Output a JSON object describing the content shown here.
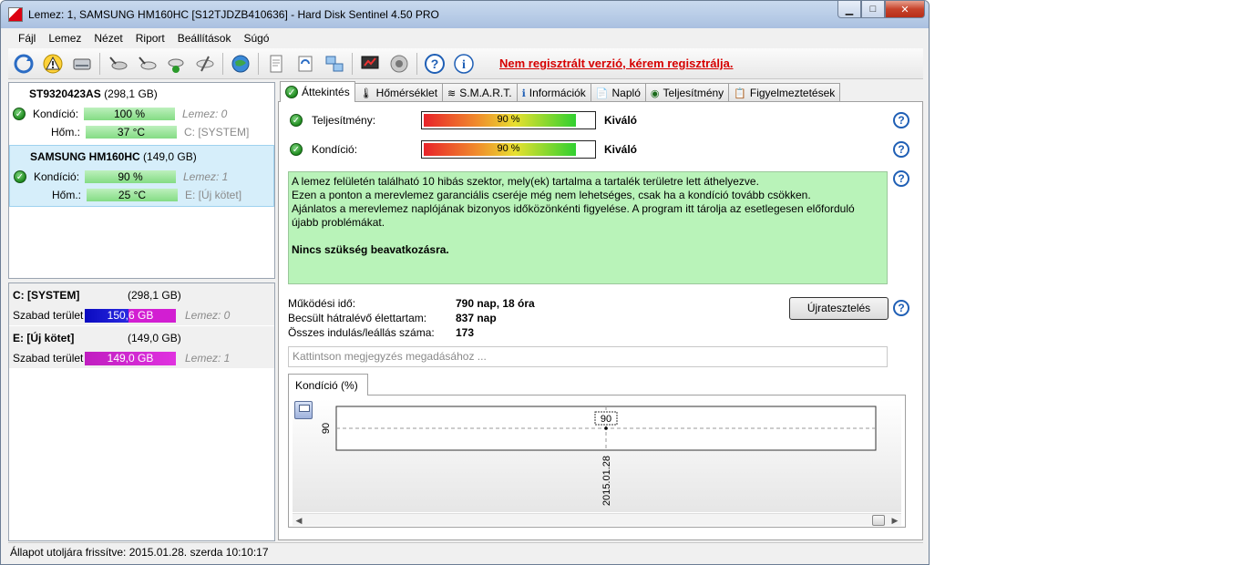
{
  "window": {
    "title": "Lemez: 1, SAMSUNG HM160HC [S12TJDZB410636]  -  Hard Disk Sentinel 4.50 PRO",
    "minimize_label": "▁",
    "maximize_label": "□",
    "close_label": "✕"
  },
  "menu": [
    {
      "label": "Fájl"
    },
    {
      "label": "Lemez"
    },
    {
      "label": "Nézet"
    },
    {
      "label": "Riport"
    },
    {
      "label": "Beállítások"
    },
    {
      "label": "Súgó"
    }
  ],
  "toolbar": {
    "icons": [
      "refresh-icon",
      "warning-icon",
      "disk-icon",
      "disk-test-icon",
      "disk-test-2-icon",
      "disk-ok-icon",
      "disk-tool-icon",
      "globe-icon",
      "report-icon",
      "sync-icon",
      "network-icon",
      "monitor-icon",
      "speaker-icon",
      "help-icon",
      "info-icon"
    ],
    "registration_notice": "Nem regisztrált verzió, kérem regisztrálja."
  },
  "disks": [
    {
      "name": "ST9320423AS",
      "capacity": "(298,1 GB)",
      "condition_label": "Kondíció:",
      "condition_value": "100 %",
      "disk_ref": "Lemez: 0",
      "temp_label": "Hőm.:",
      "temp_value": "37 °C",
      "volume_ref": "C: [SYSTEM]",
      "selected": false
    },
    {
      "name": "SAMSUNG HM160HC",
      "capacity": "(149,0 GB)",
      "condition_label": "Kondíció:",
      "condition_value": "90 %",
      "disk_ref": "Lemez: 1",
      "temp_label": "Hőm.:",
      "temp_value": "25 °C",
      "volume_ref": "E: [Új kötet]",
      "selected": true
    }
  ],
  "volumes": [
    {
      "name": "C: [SYSTEM]",
      "capacity": "(298,1 GB)",
      "free_label": "Szabad terület",
      "free_value": "150,6 GB",
      "disk_ref": "Lemez: 0",
      "bar_color": "#1414c8"
    },
    {
      "name": "E: [Új kötet]",
      "capacity": "(149,0 GB)",
      "free_label": "Szabad terület",
      "free_value": "149,0 GB",
      "disk_ref": "Lemez: 1",
      "bar_color": "#c81ec8"
    }
  ],
  "status": "Állapot utoljára frissítve: 2015.01.28. szerda 10:10:17",
  "tabs": [
    {
      "label": "Áttekintés",
      "icon": "✔",
      "active": true
    },
    {
      "label": "Hőmérséklet",
      "icon": "🌡",
      "active": false
    },
    {
      "label": "S.M.A.R.T.",
      "icon": "≋",
      "active": false
    },
    {
      "label": "Információk",
      "icon": "ℹ",
      "active": false
    },
    {
      "label": "Napló",
      "icon": "📄",
      "active": false
    },
    {
      "label": "Teljesítmény",
      "icon": "◉",
      "active": false
    },
    {
      "label": "Figyelmeztetések",
      "icon": "📋",
      "active": false
    }
  ],
  "overview": {
    "performance_label": "Teljesítmény:",
    "performance_value": "90 %",
    "performance_fraction": 0.9,
    "performance_rating": "Kiváló",
    "condition_label": "Kondíció:",
    "condition_value": "90 %",
    "condition_fraction": 0.9,
    "condition_rating": "Kiváló",
    "help": "?",
    "message_lines": [
      "A lemez felületén található 10 hibás szektor, mely(ek) tartalma a tartalék területre lett áthelyezve.",
      "Ezen a ponton a merevlemez garanciális cseréje még nem lehetséges, csak ha a kondíció tovább csökken.",
      "Ajánlatos a merevlemez naplójának bizonyos időközönkénti figyelése. A program itt tárolja az esetlegesen előforduló újabb problémákat."
    ],
    "message_conclusion": "Nincs szükség beavatkozásra.",
    "stats": [
      {
        "label": "Működési idő:",
        "value": "790 nap, 18 óra"
      },
      {
        "label": "Becsült hátralévő élettartam:",
        "value": "837 nap"
      },
      {
        "label": "Összes indulás/leállás száma:",
        "value": "173"
      }
    ],
    "retest_button": "Újratesztelés",
    "note_placeholder": "Kattintson megjegyzés megadásához ..."
  },
  "chart_tab_label": "Kondíció  (%)",
  "chart_data": {
    "type": "line",
    "x": [
      "2015.01.28"
    ],
    "values": [
      90
    ],
    "ylabel": "",
    "y_ticks": [
      "90"
    ],
    "data_labels": [
      "90"
    ],
    "grid": true
  }
}
